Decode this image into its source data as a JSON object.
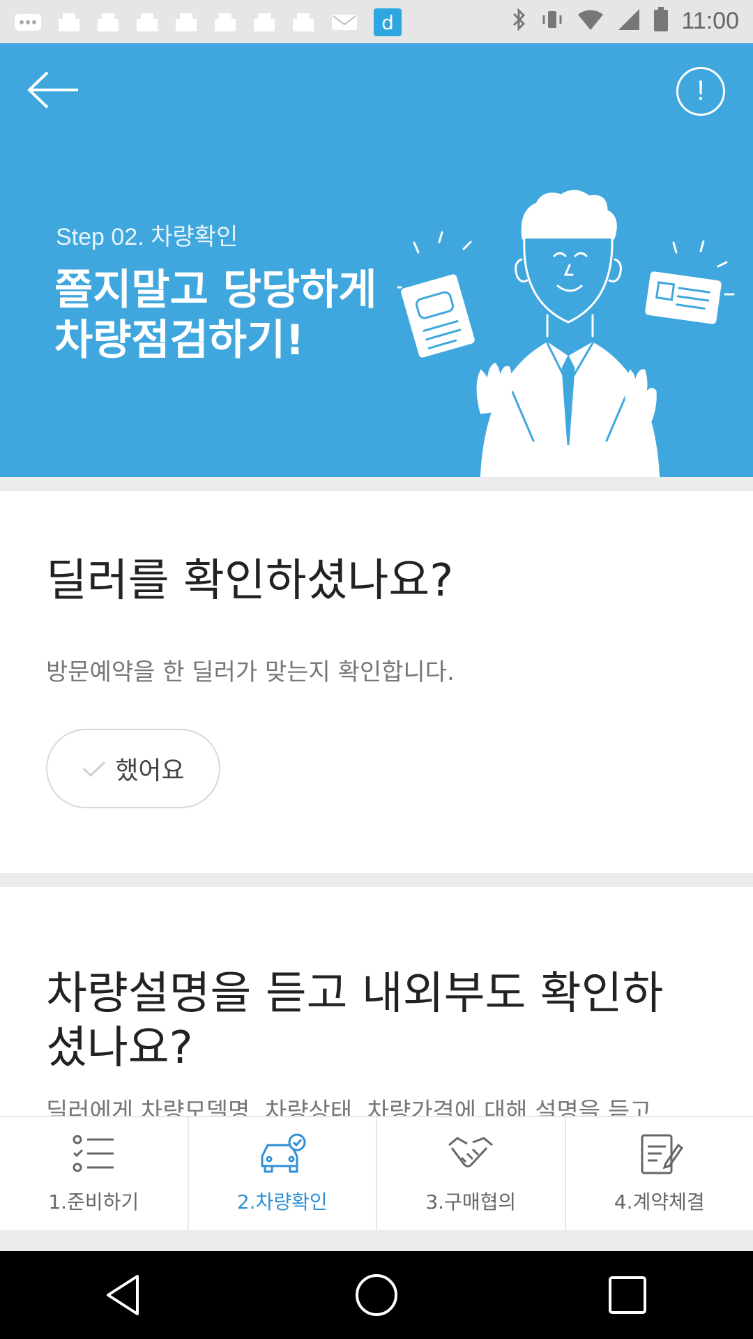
{
  "status_bar": {
    "time": "11:00"
  },
  "hero": {
    "step_label": "Step 02. 차량확인",
    "title": "쫄지말고 당당하게\n차량점검하기!",
    "info_glyph": "!",
    "bg_color": "#3fa7dd"
  },
  "question1": {
    "title": "딜러를 확인하셨나요?",
    "description": "방문예약을 한 딜러가 맞는지 확인합니다.",
    "button_label": "했어요"
  },
  "question2": {
    "title": "차량설명을 듣고 내외부도 확인하\n셨나요?",
    "description": "딜러에게 차량모델명, 차량상태, 차량가격에 대해 설명을 듣고"
  },
  "bottom_nav": {
    "tabs": [
      {
        "label": "1.준비하기",
        "icon": "checklist-icon"
      },
      {
        "label": "2.차량확인",
        "icon": "car-check-icon",
        "active": true
      },
      {
        "label": "3.구매협의",
        "icon": "handshake-icon"
      },
      {
        "label": "4.계약체결",
        "icon": "contract-icon"
      }
    ],
    "active_color": "#2f8fd4"
  }
}
